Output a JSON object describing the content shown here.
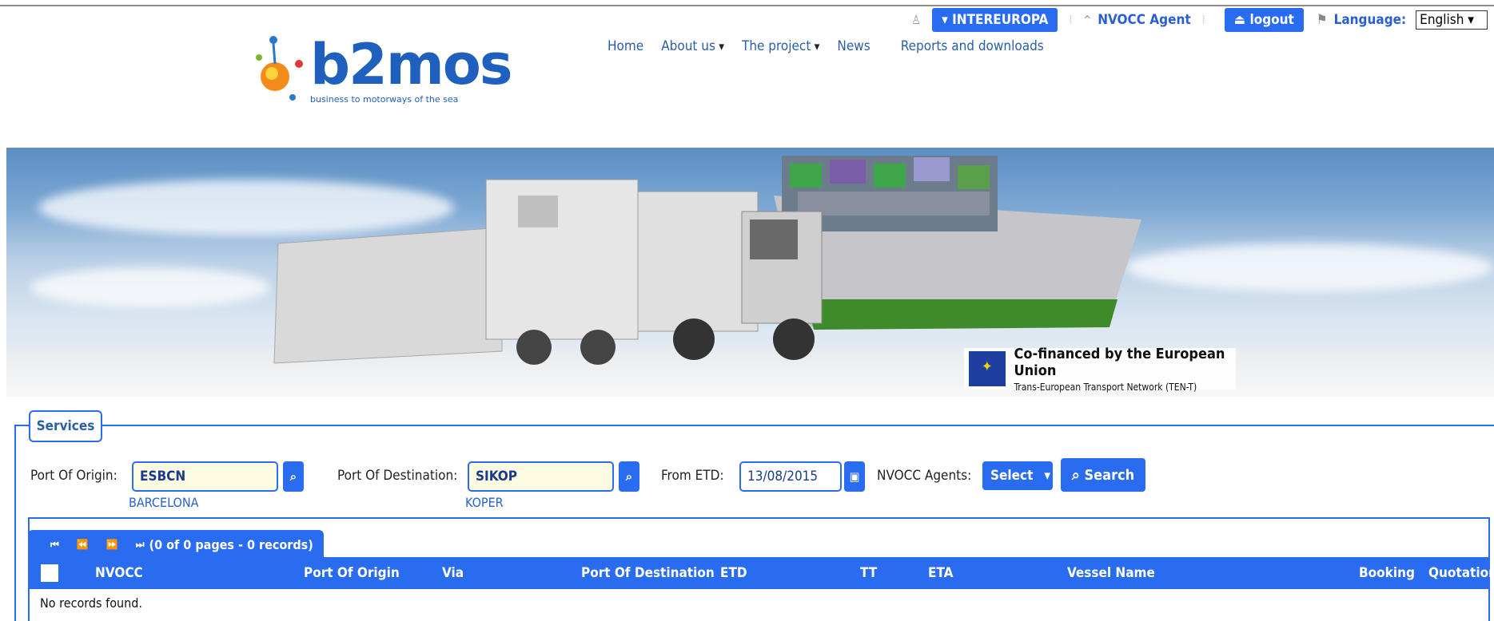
{
  "user_bar": {
    "company": "INTEREUROPA",
    "agent": "NVOCC Agent",
    "logout": "logout",
    "language_label": "Language:",
    "language_value": "English"
  },
  "logo": {
    "word": "b2mos",
    "tagline": "business to motorways of the sea"
  },
  "nav": [
    "Home",
    "About us",
    "The project",
    "News",
    "Reports and downloads"
  ],
  "eu": {
    "line1": "Co-financed by the European Union",
    "line2": "Trans-European Transport Network (TEN-T)"
  },
  "services": {
    "tab": "Services",
    "origin_label": "Port Of Origin:",
    "origin_value": "ESBCN",
    "origin_name": "BARCELONA",
    "dest_label": "Port Of Destination:",
    "dest_value": "SIKOP",
    "dest_name": "KOPER",
    "etd_label": "From ETD:",
    "etd_value": "13/08/2015",
    "agents_label": "NVOCC Agents:",
    "agents_select": "Select",
    "search": "Search"
  },
  "grid": {
    "pager_text": "(0 of 0 pages - 0 records)",
    "columns": [
      "NVOCC",
      "Port Of Origin",
      "Via",
      "Port Of Destination",
      "ETD",
      "TT",
      "ETA",
      "Vessel Name",
      "Booking",
      "Quotation"
    ],
    "empty": "No records found."
  }
}
